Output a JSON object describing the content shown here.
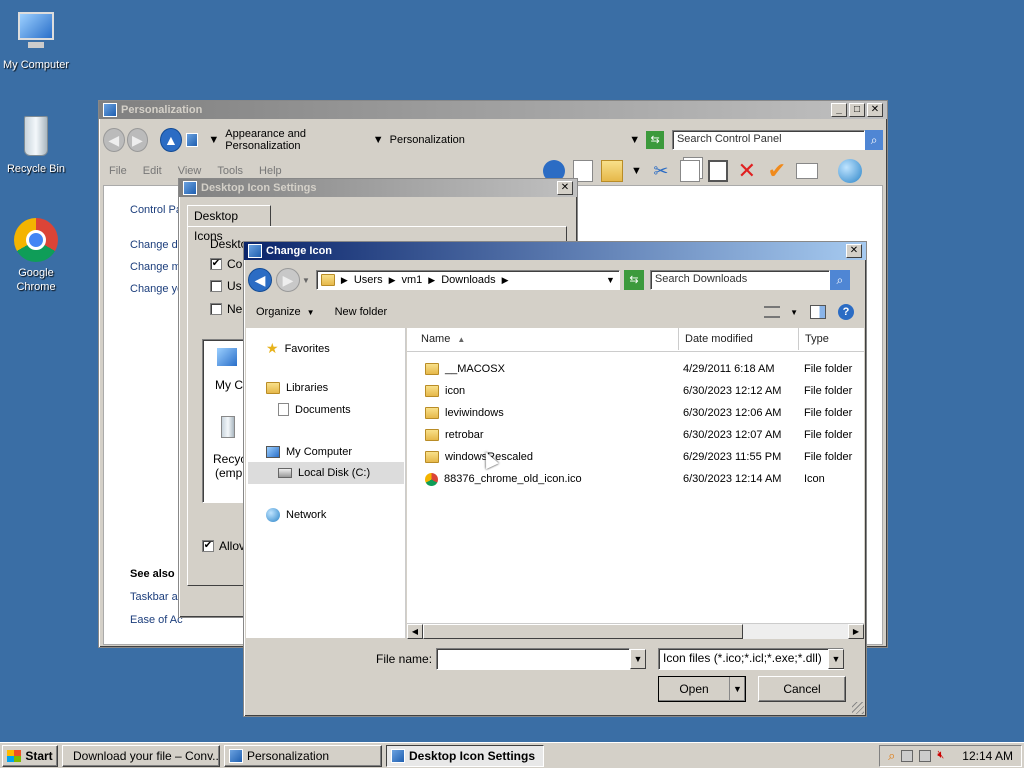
{
  "desktop": {
    "icons": [
      {
        "label": "My Computer"
      },
      {
        "label": "Recycle Bin"
      },
      {
        "label": "Google Chrome"
      }
    ]
  },
  "personalization": {
    "title": "Personalization",
    "breadcrumb": [
      "Appearance and Personalization",
      "Personalization"
    ],
    "search_placeholder": "Search Control Panel",
    "menu": [
      "File",
      "Edit",
      "View",
      "Tools",
      "Help"
    ],
    "left_links": [
      "Control Pa",
      "Change de",
      "Change m",
      "Change yo"
    ],
    "see_also": "See also",
    "see_links": [
      "Taskbar ar",
      "Ease of Ac"
    ]
  },
  "desktop_icon_settings": {
    "title": "Desktop Icon Settings",
    "tab": "Desktop Icons",
    "group_label": "Deskto",
    "checkboxes": [
      {
        "label": "Co",
        "checked": true
      },
      {
        "label": "Us",
        "checked": false
      },
      {
        "label": "Ne",
        "checked": false
      }
    ],
    "preview_items": [
      "My Co",
      "Recyc",
      "(emp"
    ],
    "allow_label": "Allov"
  },
  "change_icon": {
    "title": "Change Icon",
    "address": [
      "Users",
      "vm1",
      "Downloads"
    ],
    "search_placeholder": "Search Downloads",
    "toolbar": {
      "organize": "Organize",
      "new_folder": "New folder"
    },
    "nav": {
      "favorites": "Favorites",
      "libraries": "Libraries",
      "documents": "Documents",
      "my_computer": "My Computer",
      "local_disk": "Local Disk (C:)",
      "network": "Network"
    },
    "columns": {
      "name": "Name",
      "date": "Date modified",
      "type": "Type"
    },
    "files": [
      {
        "name": "__MACOSX",
        "date": "4/29/2011 6:18 AM",
        "type": "File folder",
        "icon": "folder-icon"
      },
      {
        "name": "icon",
        "date": "6/30/2023 12:12 AM",
        "type": "File folder",
        "icon": "folder-icon"
      },
      {
        "name": "leviwindows",
        "date": "6/30/2023 12:06 AM",
        "type": "File folder",
        "icon": "folder-icon"
      },
      {
        "name": "retrobar",
        "date": "6/30/2023 12:07 AM",
        "type": "File folder",
        "icon": "folder-icon"
      },
      {
        "name": "windowsRescaled",
        "date": "6/29/2023 11:55 PM",
        "type": "File folder",
        "icon": "folder-icon"
      },
      {
        "name": "88376_chrome_old_icon.ico",
        "date": "6/30/2023 12:14 AM",
        "type": "Icon",
        "icon": "chrome-icon"
      }
    ],
    "file_name_label": "File name:",
    "file_name_value": "",
    "filter": "Icon files (*.ico;*.icl;*.exe;*.dll)",
    "open": "Open",
    "cancel": "Cancel"
  },
  "taskbar": {
    "start": "Start",
    "tasks": [
      "Download your file – Conv...",
      "Personalization",
      "Desktop Icon Settings"
    ],
    "clock": "12:14 AM"
  }
}
